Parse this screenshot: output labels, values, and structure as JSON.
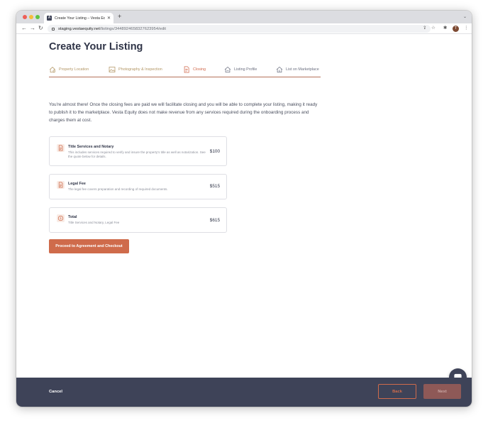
{
  "browser": {
    "tab_title": "Create Your Listing – Vesta Eq",
    "favicon_letter": "A",
    "url_host": "staging.vestaequity.net",
    "url_path": "/listings/344892465832762395​4/edit",
    "profile_initial": "T"
  },
  "page": {
    "title": "Create Your Listing",
    "steps": [
      {
        "label": "Property Location",
        "icon": "house-pin-icon",
        "state": "complete"
      },
      {
        "label": "Photography & Inspection",
        "icon": "photo-icon",
        "state": "complete"
      },
      {
        "label": "Closing",
        "icon": "document-icon",
        "state": "active"
      },
      {
        "label": "Listing Profile",
        "icon": "house-icon",
        "state": "upcoming"
      },
      {
        "label": "List on Marketplace",
        "icon": "house-dollar-icon",
        "state": "upcoming"
      }
    ],
    "intro": "You're almost there! Once the closing fees are paid we will facilitate closing and you will be able to complete your listing, making it ready to publish it to the marketplace. Vesta Equity does not make revenue from any services required during the onboarding process and charges them at cost.",
    "fees": [
      {
        "title": "Title Services and Notary",
        "description": "This includes services required to verify and insure the property's title as well as notarization. See the quote below for details.",
        "price": "$100",
        "icon": "document-icon"
      },
      {
        "title": "Legal Fee",
        "description": "The legal fee covers preparation and recording of required documents.",
        "price": "$515",
        "icon": "document-icon"
      },
      {
        "title": "Total",
        "description": "Title Services and Notary, Legal Fee",
        "price": "$615",
        "icon": "dollar-circle-icon"
      }
    ],
    "proceed_label": "Proceed to Agreement and Checkout"
  },
  "footer": {
    "cancel_label": "Cancel",
    "back_label": "Back",
    "next_label": "Next"
  },
  "colors": {
    "accent": "#cf6b4b",
    "footer_bg": "#3e4358",
    "complete_step": "#b29563"
  }
}
